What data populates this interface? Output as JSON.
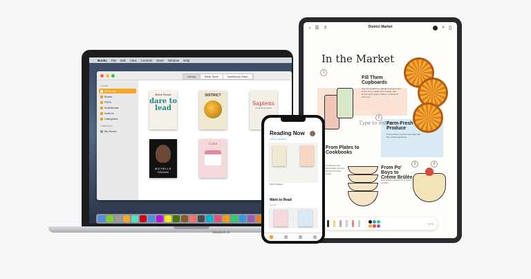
{
  "macbook": {
    "model_label": "MacBook Air",
    "menubar": [
      "Books",
      "File",
      "Edit",
      "View",
      "Controls",
      "Store",
      "Window",
      "Help"
    ],
    "segments": [
      "Library",
      "Book Store",
      "Audiobook Store"
    ],
    "sidebar": {
      "library_heading": "Library",
      "items": [
        "All Books",
        "Books",
        "PDFs",
        "Audiobooks",
        "Authors",
        "Categories"
      ],
      "collections_heading": "Collections",
      "collection_items": [
        "My Books"
      ]
    },
    "books": {
      "b1_author": "Brené Brown",
      "b1_title": "dare to lead",
      "b2_title": "DISTRICT",
      "b3_title": "Sapiens",
      "b3_sub": "Yuval Noah Harari",
      "b4_title": "MICHELLE OBAMA",
      "b5_title": "Cake"
    },
    "dock_colors": [
      "#4a90e2",
      "#7ed321",
      "#9b9b9b",
      "#f5a623",
      "#50e3c2",
      "#d0021b",
      "#4a90e2",
      "#bd10e0",
      "#f8e71c",
      "#417505",
      "#8b572a",
      "#ff6f61",
      "#4a4a4a",
      "#00b4d8",
      "#e94e77",
      "#f39c12",
      "#2ecc71",
      "#3498db",
      "#9b59b6",
      "#e67e22",
      "#1abc9c",
      "#34495e"
    ]
  },
  "ipad": {
    "title": "District Market",
    "heading": "In the Market",
    "sections": [
      {
        "number": "1",
        "title": "Fill Them Cupboards"
      },
      {
        "number": "2",
        "title": "Farm-Fresh Produce"
      },
      {
        "number": "3",
        "title": "From Plates to Cookbooks"
      },
      {
        "number": "4",
        "title": "From Po' Boys to Crème Brûlée"
      }
    ],
    "handwriting": "Type to enter",
    "body_snippets": [
      "A jar of tomatoes is nothing to be ignored in winter, but a market chef's pantry also stocks great quality coffees, condiments, and more.",
      "Ernest Marion and his crew start with farm-fresh ingredients.",
      "Cookbooks and kitchenware line the shelves for home cooks.",
      "New Orleans classics from local vendors."
    ],
    "swatch_colors": [
      "#111111",
      "#4a90e2",
      "#2ecc71",
      "#f5a623",
      "#e74c3c",
      "#9b59b6"
    ]
  },
  "iphone": {
    "title": "Reading Now",
    "subtitle": "Continue Reading",
    "current_book": "District Market",
    "want_to_read": "Want to Read",
    "want_sub": "See All"
  }
}
